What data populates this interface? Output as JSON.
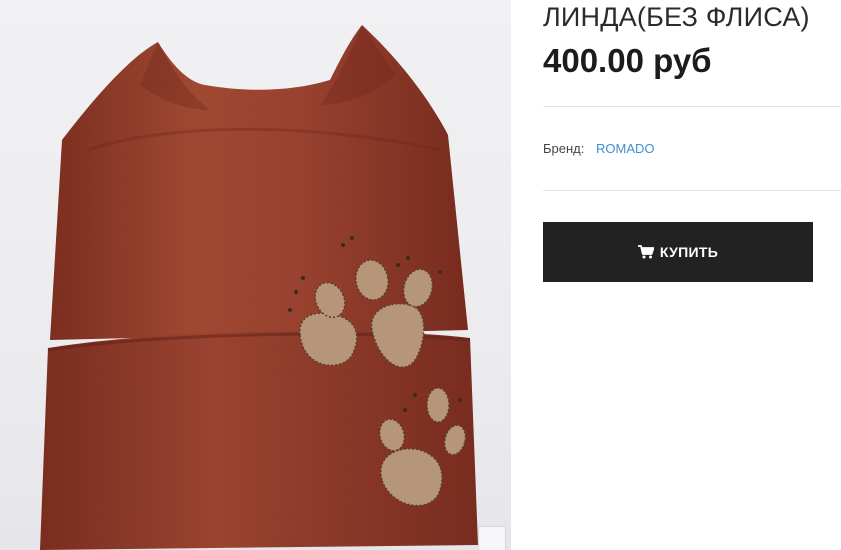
{
  "product": {
    "title": "ЛИНДА(БЕЗ ФЛИСА)",
    "price": "400.00 руб",
    "brand_label": "Бренд:",
    "brand_name": "ROMADO",
    "buy_label": "КУПИТЬ",
    "image_icon": "knit-hat-product-photo"
  },
  "colors": {
    "button_bg": "#222222",
    "brand_link": "#3f8fd2",
    "hat": "#9a3f2c"
  }
}
